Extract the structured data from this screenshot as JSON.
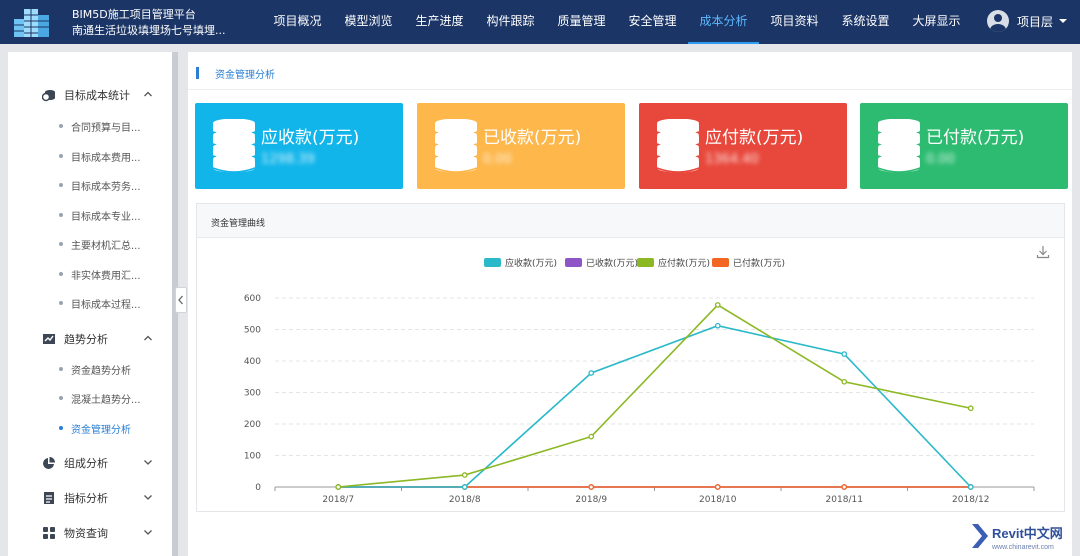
{
  "header": {
    "app_title": "BIM5D施工项目管理平台",
    "project_name": "南通生活垃圾填埋场七号填埋...",
    "nav": [
      "项目概况",
      "模型浏览",
      "生产进度",
      "构件跟踪",
      "质量管理",
      "安全管理",
      "成本分析",
      "项目资料",
      "系统设置",
      "大屏显示"
    ],
    "active_nav": "成本分析",
    "user_label": "项目层"
  },
  "sidebar": {
    "groups": [
      {
        "label": "目标成本统计",
        "icon": "coins-icon",
        "expanded": true,
        "items": [
          "合同预算与目...",
          "目标成本费用...",
          "目标成本劳务...",
          "目标成本专业...",
          "主要材机汇总...",
          "非实体费用汇...",
          "目标成本过程..."
        ]
      },
      {
        "label": "趋势分析",
        "icon": "trend-chart-icon",
        "expanded": true,
        "items": [
          "资金趋势分析",
          "混凝土趋势分...",
          "资金管理分析"
        ]
      },
      {
        "label": "组成分析",
        "icon": "pie-chart-icon",
        "expanded": false,
        "items": []
      },
      {
        "label": "指标分析",
        "icon": "report-icon",
        "expanded": false,
        "items": []
      },
      {
        "label": "物资查询",
        "icon": "grid-icon",
        "expanded": false,
        "items": []
      }
    ],
    "active_item": "资金管理分析"
  },
  "main": {
    "title": "资金管理分析",
    "cards": [
      {
        "label": "应收款(万元)",
        "value": "1298.39",
        "color": "#12b5ea"
      },
      {
        "label": "已收款(万元)",
        "value": "0.00",
        "color": "#fdb74b"
      },
      {
        "label": "应付款(万元)",
        "value": "1364.40",
        "color": "#e8483c"
      },
      {
        "label": "已付款(万元)",
        "value": "0.00",
        "color": "#2dbb71"
      }
    ],
    "panel_title": "资金管理曲线"
  },
  "chart_data": {
    "type": "line",
    "categories": [
      "2018/7",
      "2018/8",
      "2018/9",
      "2018/10",
      "2018/11",
      "2018/12"
    ],
    "ylim": [
      0,
      600
    ],
    "yticks": [
      0,
      100,
      200,
      300,
      400,
      500,
      600
    ],
    "grid": true,
    "legend_position": "top-center",
    "series": [
      {
        "name": "应收款(万元)",
        "color": "#29b9c8",
        "values": [
          0,
          0,
          362,
          512,
          422,
          0
        ]
      },
      {
        "name": "已收款(万元)",
        "color": "#8e55c7",
        "values": [
          0,
          0,
          0,
          0,
          0,
          0
        ]
      },
      {
        "name": "应付款(万元)",
        "color": "#8cb824",
        "values": [
          0,
          38,
          160,
          578,
          334,
          250
        ]
      },
      {
        "name": "已付款(万元)",
        "color": "#f26522",
        "values": [
          0,
          0,
          0,
          0,
          0,
          0
        ]
      }
    ]
  },
  "watermark": {
    "brand": "Revit中文网",
    "url": "www.chinarevit.com"
  }
}
